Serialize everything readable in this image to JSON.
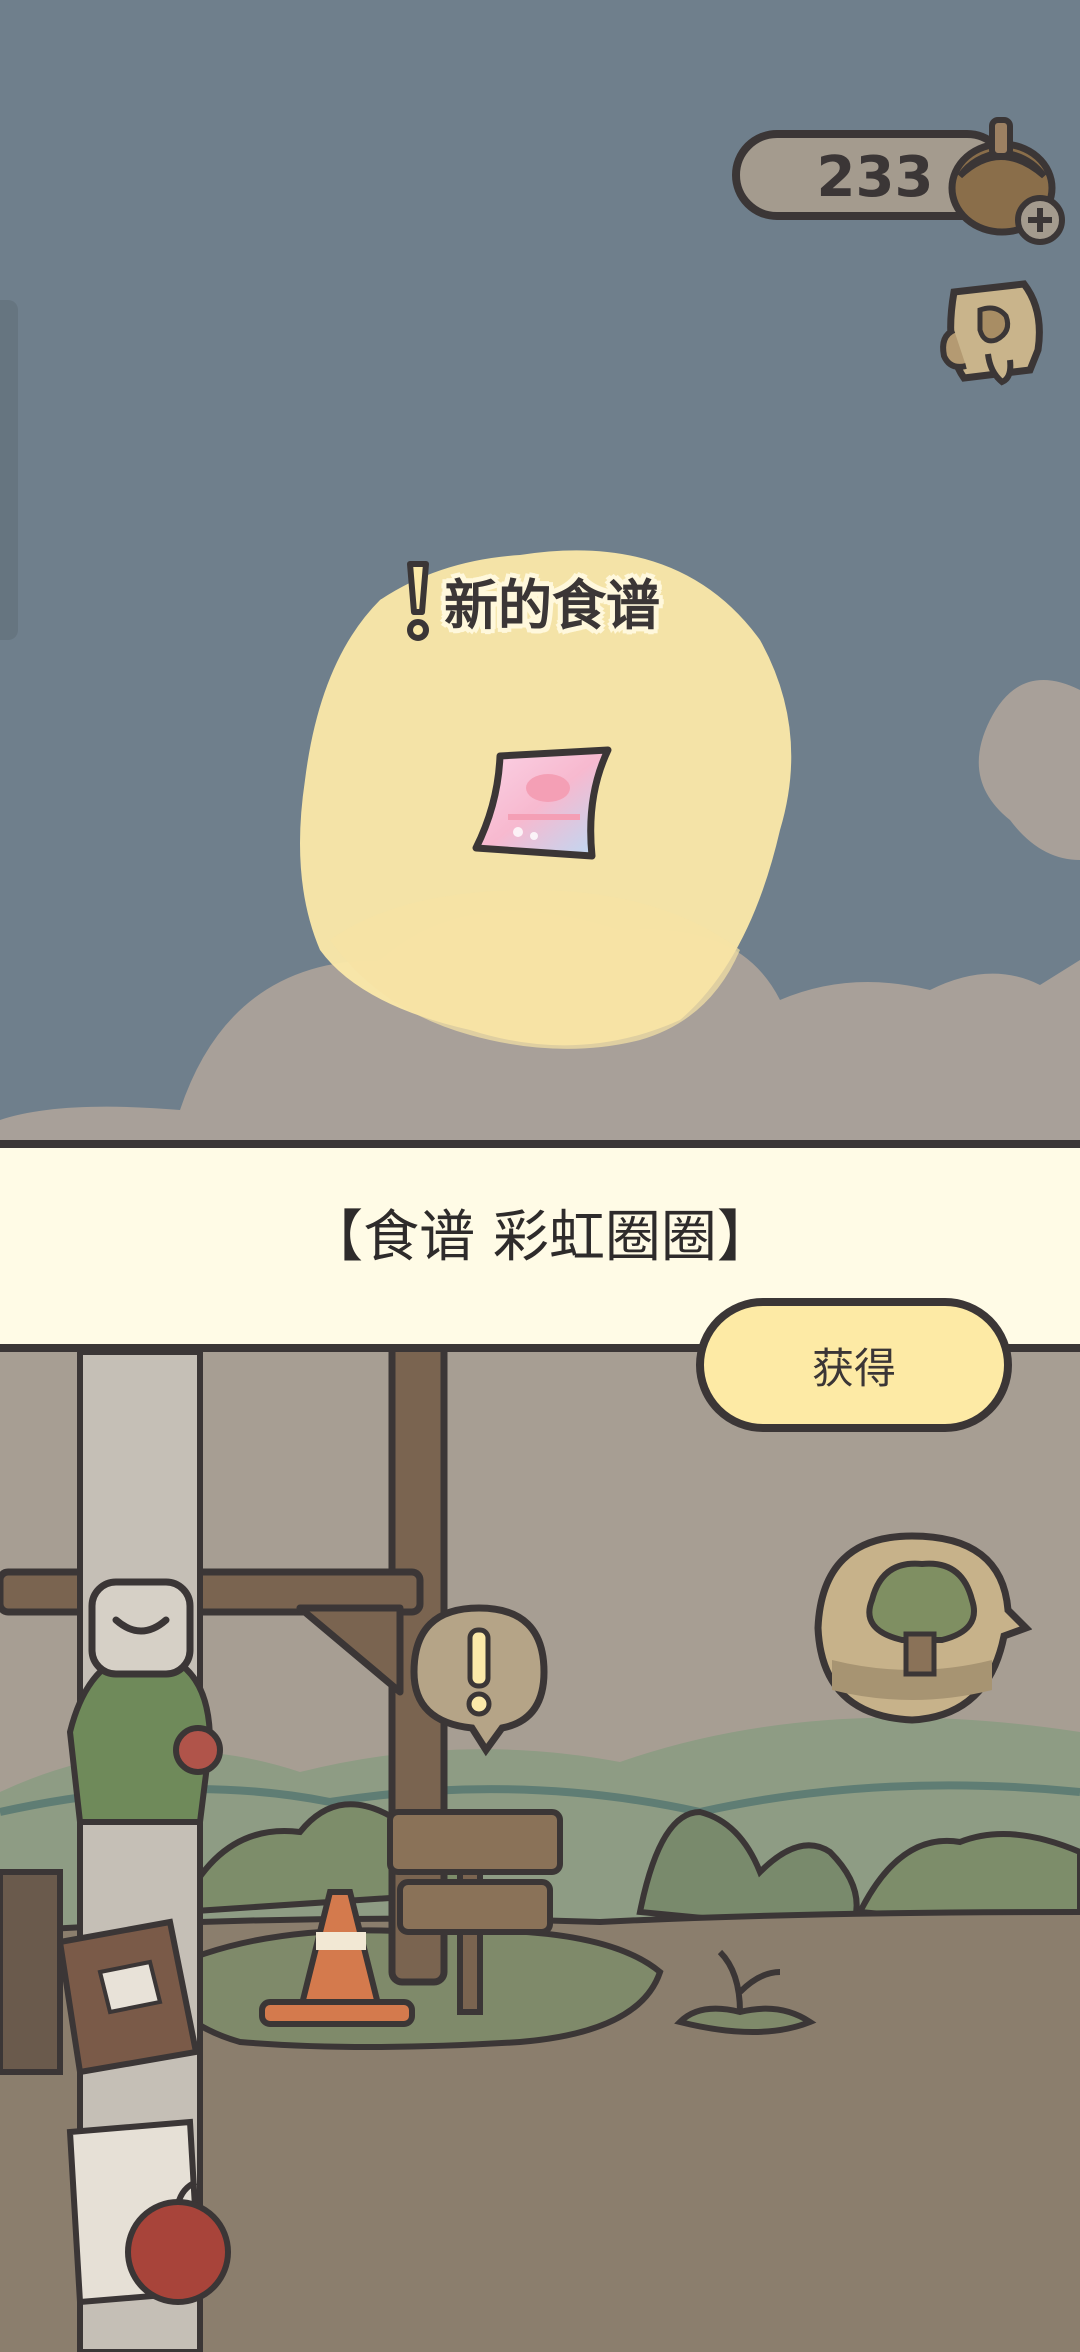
{
  "hud": {
    "currency_value": "233",
    "currency_icon": "acorn-icon",
    "menu_icon": "scroll-icon"
  },
  "popup": {
    "title": "新的食谱",
    "item_icon": "rainbow-recipe-card-icon",
    "item_name": "【食谱 彩虹圈圈】",
    "obtain_label": "获得"
  },
  "scene": {
    "sign_icon": "exclamation-bubble-icon",
    "tree_bubble_icon": "tree-house-bubble-icon",
    "chat_icon": "chevron-down-bubble-icon"
  },
  "colors": {
    "sky": "#6f7f8c",
    "glow": "#fbe9a9",
    "banner": "#fffbe6",
    "button": "#fdeaa5",
    "outline": "#3b3636"
  }
}
